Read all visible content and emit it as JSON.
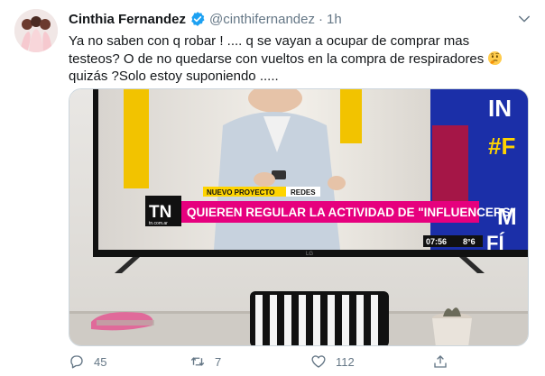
{
  "tweet": {
    "author_name": "Cinthia Fernandez",
    "handle": "@cinthifernandez",
    "separator": "·",
    "time": "1h",
    "text_lines": [
      "Ya no saben con q robar ! .... q se vayan a ocupar de comprar mas",
      "testeos? O de no quedarse con vueltos en la compra de respiradores",
      "quizás ?Solo estoy suponiendo ....."
    ],
    "emoji": "thinking-face"
  },
  "media": {
    "tv_tag_left": "NUEVO PROYECTO",
    "tv_tag_right": "REDES",
    "tv_headline": "QUIEREN REGULAR LA ACTIVIDAD DE \"INFLUENCERS\"",
    "tv_logo": "TN",
    "tv_logo_sub": "tn.com.ar",
    "tv_clock": "07:56",
    "tv_temp": "8°6",
    "tv_side_lines": [
      "IN",
      "#F",
      "M",
      "FÍ"
    ],
    "tv_brand": "LG"
  },
  "actions": {
    "reply_count": "45",
    "retweet_count": "7",
    "like_count": "112"
  },
  "colors": {
    "accent": "#1da1f2",
    "muted": "#657786",
    "tv_banner": "#e6007e",
    "tv_tag": "#ffd400"
  }
}
